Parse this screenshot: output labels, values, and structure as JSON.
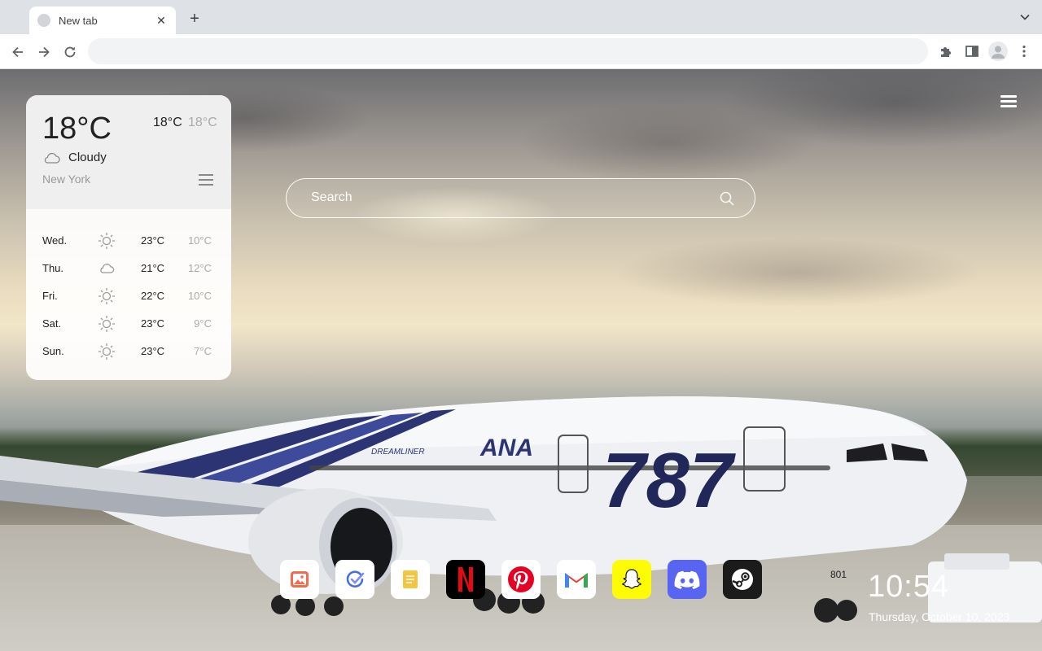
{
  "browser": {
    "tab_title": "New tab",
    "new_tab_symbol": "+",
    "close_symbol": "✕",
    "omnibox_value": ""
  },
  "weather": {
    "current_temp": "18°C",
    "high": "18°C",
    "low": "18°C",
    "condition": "Cloudy",
    "city": "New York",
    "forecast": [
      {
        "day": "Wed.",
        "icon": "sun-icon",
        "high": "23°C",
        "low": "10°C"
      },
      {
        "day": "Thu.",
        "icon": "cloud-icon",
        "high": "21°C",
        "low": "12°C"
      },
      {
        "day": "Fri.",
        "icon": "sun-icon",
        "high": "22°C",
        "low": "10°C"
      },
      {
        "day": "Sat.",
        "icon": "sun-icon",
        "high": "23°C",
        "low": "9°C"
      },
      {
        "day": "Sun.",
        "icon": "sun-icon",
        "high": "23°C",
        "low": "7°C"
      }
    ]
  },
  "search": {
    "placeholder": "Search"
  },
  "dock": [
    {
      "name": "wallpaper-app",
      "bg": "#ffffff"
    },
    {
      "name": "tasks-app",
      "bg": "#ffffff"
    },
    {
      "name": "notes-app",
      "bg": "#ffffff"
    },
    {
      "name": "netflix-app",
      "bg": "#000000"
    },
    {
      "name": "pinterest-app",
      "bg": "#ffffff"
    },
    {
      "name": "gmail-app",
      "bg": "#ffffff"
    },
    {
      "name": "snapchat-app",
      "bg": "#fffc00"
    },
    {
      "name": "discord-app",
      "bg": "#5865f2"
    },
    {
      "name": "steam-app",
      "bg": "#1b1b1b"
    }
  ],
  "clock": {
    "time": "10:54",
    "date": "Thursday, October 10, 2023"
  },
  "plane_text": {
    "model": "787",
    "airline": "ANA",
    "dreamliner": "DREAMLINER",
    "reg": "801"
  }
}
